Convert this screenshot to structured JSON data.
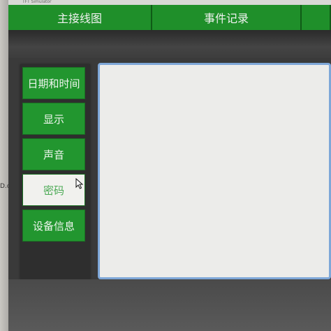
{
  "window": {
    "title": "TFT Simulator"
  },
  "left_margin_text": "D.c",
  "topnav": {
    "tabs": [
      {
        "label": "主接线图"
      },
      {
        "label": "事件记录"
      },
      {
        "label": ""
      }
    ]
  },
  "sidebar": {
    "items": [
      {
        "label": "日期和时间",
        "active": false
      },
      {
        "label": "显示",
        "active": false
      },
      {
        "label": "声音",
        "active": false
      },
      {
        "label": "密码",
        "active": true
      },
      {
        "label": "设备信息",
        "active": false
      }
    ]
  },
  "colors": {
    "nav_green": "#1f8f2a",
    "button_green": "#22962f",
    "active_bg": "#f1f1ee",
    "panel_bg": "#ececea",
    "panel_border": "#7ea7d8"
  },
  "icons": {
    "cursor": "mouse-pointer-icon"
  }
}
